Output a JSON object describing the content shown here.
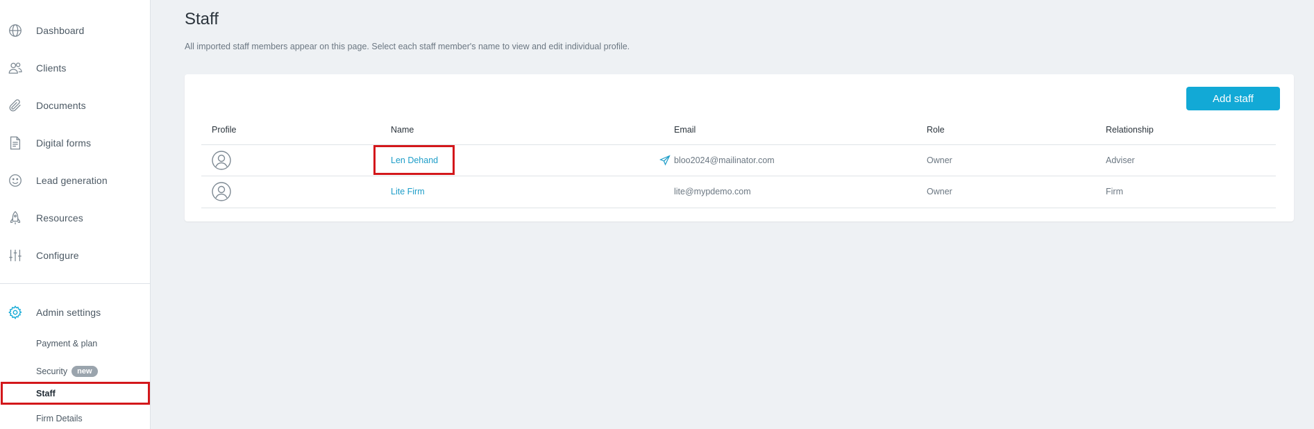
{
  "sidebar": {
    "items": [
      {
        "label": "Dashboard",
        "icon": "globe-icon"
      },
      {
        "label": "Clients",
        "icon": "users-icon"
      },
      {
        "label": "Documents",
        "icon": "paperclip-icon"
      },
      {
        "label": "Digital forms",
        "icon": "document-icon"
      },
      {
        "label": "Lead generation",
        "icon": "smiley-icon"
      },
      {
        "label": "Resources",
        "icon": "rocket-icon"
      },
      {
        "label": "Configure",
        "icon": "sliders-icon"
      }
    ],
    "admin": {
      "label": "Admin settings",
      "icon": "gear-icon"
    },
    "sub_items": [
      {
        "label": "Payment & plan"
      },
      {
        "label": "Security",
        "badge": "new"
      },
      {
        "label": "Staff"
      },
      {
        "label": "Firm Details"
      }
    ]
  },
  "page": {
    "title": "Staff",
    "description": "All imported staff members appear on this page. Select each staff member's name to view and edit individual profile."
  },
  "toolbar": {
    "add_label": "Add staff"
  },
  "table": {
    "headers": {
      "profile": "Profile",
      "name": "Name",
      "email": "Email",
      "role": "Role",
      "relationship": "Relationship"
    },
    "rows": [
      {
        "name": "Len Dehand",
        "email": "bloo2024@mailinator.com",
        "role": "Owner",
        "relationship": "Adviser",
        "email_icon": "send-icon"
      },
      {
        "name": "Lite Firm",
        "email": "lite@mypdemo.com",
        "role": "Owner",
        "relationship": "Firm"
      }
    ]
  },
  "colors": {
    "accent": "#12a9d6",
    "highlight": "#d3171b",
    "admin_icon": "#12a9d6"
  }
}
